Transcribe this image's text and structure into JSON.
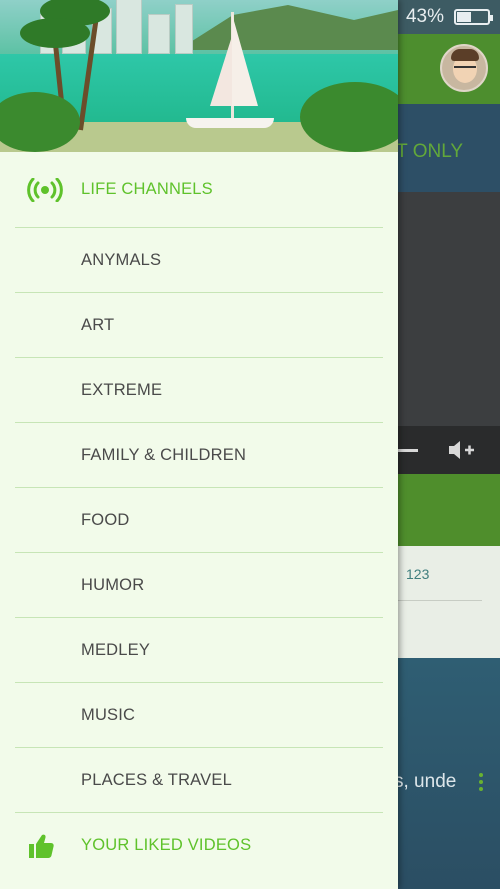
{
  "status_bar": {
    "battery_percent": "43%",
    "battery_level": 0.43
  },
  "background_app": {
    "tab_text": "LT ONLY",
    "count": "123",
    "description_snippet": "s, unde"
  },
  "drawer": {
    "items": [
      {
        "label": "LIFE CHANNELS",
        "icon": "broadcast-icon",
        "accent": true
      },
      {
        "label": "ANYMALS"
      },
      {
        "label": "ART"
      },
      {
        "label": "EXTREME"
      },
      {
        "label": "FAMILY & CHILDREN"
      },
      {
        "label": "FOOD"
      },
      {
        "label": "HUMOR"
      },
      {
        "label": "MEDLEY"
      },
      {
        "label": "MUSIC"
      },
      {
        "label": "PLACES & TRAVEL"
      },
      {
        "label": "YOUR LIKED VIDEOS",
        "icon": "thumbs-up-icon",
        "accent": true
      }
    ]
  },
  "colors": {
    "accent_green": "#5fc22b",
    "drawer_background": "#f2fbea",
    "divider": "#c7e5b6",
    "header_green": "#4d8e2e"
  }
}
